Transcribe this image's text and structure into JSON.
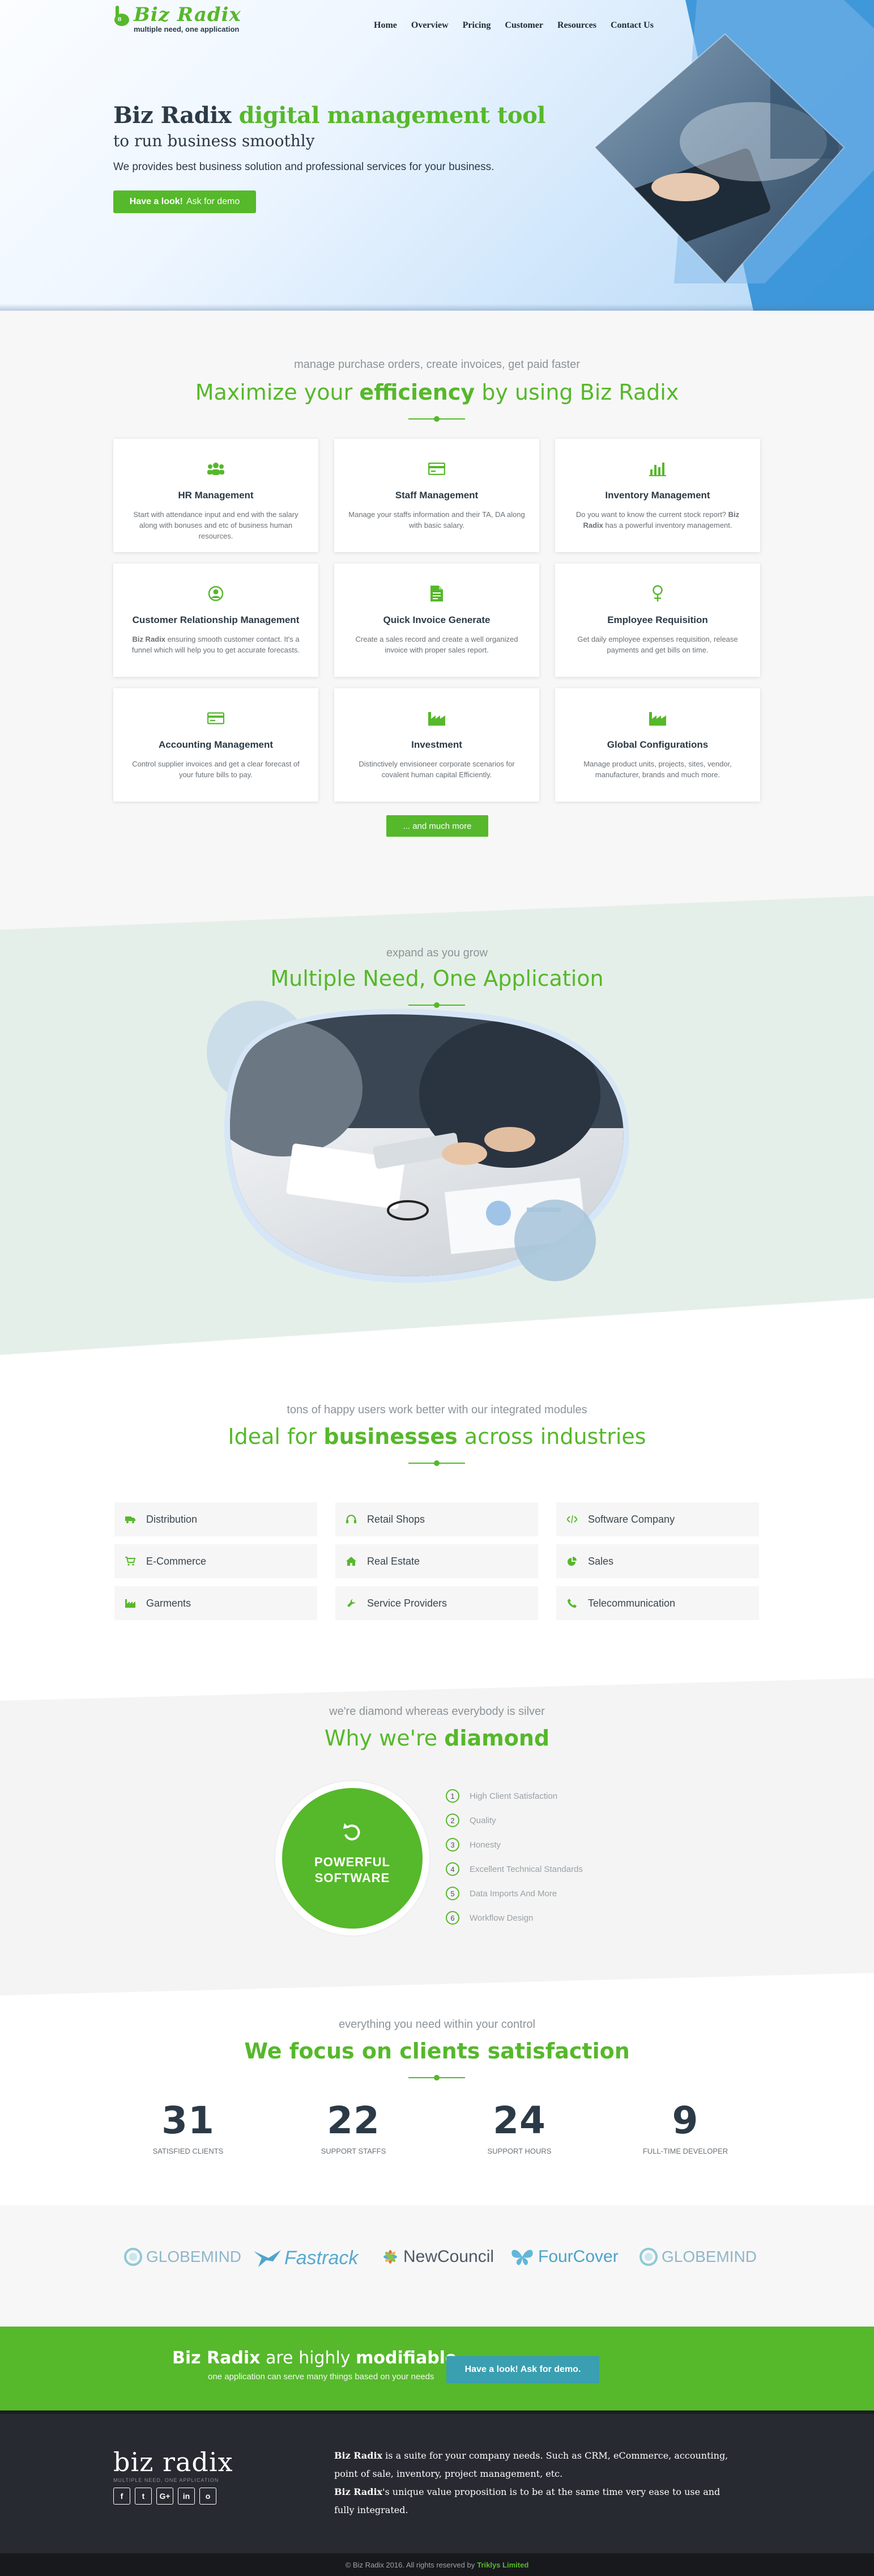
{
  "brand": {
    "name": "Biz Radix",
    "logo_badge": "B",
    "tagline": "multiple need, one application"
  },
  "nav": [
    "Home",
    "Overview",
    "Pricing",
    "Customer",
    "Resources",
    "Contact Us"
  ],
  "hero": {
    "title_plain": "Biz Radix ",
    "title_highlight": "digital management tool",
    "subtitle": "to run business smoothly",
    "description": "We provides best business solution and professional services for your business.",
    "cta_bold": "Have a look!",
    "cta_text": "Ask for demo"
  },
  "features": {
    "sub": "manage purchase orders, create invoices, get paid faster",
    "title_a": "Maximize your ",
    "title_b": "efficiency",
    "title_c": " by using Biz Radix",
    "cards": [
      {
        "icon": "users-icon",
        "title": "HR Management",
        "text": "Start with attendance input and end with the salary along with bonuses and etc of business human resources."
      },
      {
        "icon": "card-icon",
        "title": "Staff Management",
        "text": "Manage your staffs information and their TA, DA along with basic salary."
      },
      {
        "icon": "bar-chart-icon",
        "title": "Inventory Management",
        "text_a": "Do you want to know the current stock report? ",
        "text_b": "Biz Radix",
        "text_c": " has a powerful inventory management."
      },
      {
        "icon": "user-circle-icon",
        "title": "Customer Relationship Management",
        "text_a": "",
        "text_b": "Biz Radix",
        "text_c": " ensuring smooth customer contact. It's a funnel which will help you to get accurate forecasts."
      },
      {
        "icon": "invoice-icon",
        "title": "Quick Invoice Generate",
        "text": "Create a sales record and create a well organized invoice with proper sales report."
      },
      {
        "icon": "female-icon",
        "title": "Employee Requisition",
        "text": "Get daily employee expenses requisition, release payments and get bills on time."
      },
      {
        "icon": "money-icon",
        "title": "Accounting Management",
        "text": "Control supplier invoices and get a clear forecast of your future bills to pay."
      },
      {
        "icon": "industry-icon",
        "title": "Investment",
        "text": "Distinctively envisioneer corporate scenarios for covalent human capital Efficiently."
      },
      {
        "icon": "industry-icon",
        "title": "Global Configurations",
        "text": "Manage product units, projects, sites, vendor, manufacturer, brands and much more."
      }
    ],
    "more_button": "... and much more"
  },
  "expand": {
    "sub": "expand as you grow",
    "title": "Multiple Need, One Application"
  },
  "industries": {
    "sub": "tons of happy users work better with our integrated modules",
    "title_a": "Ideal for ",
    "title_b": "businesses",
    "title_c": " across industries",
    "items": [
      {
        "icon": "truck-icon",
        "label": "Distribution"
      },
      {
        "icon": "headset-icon",
        "label": "Retail Shops"
      },
      {
        "icon": "code-icon",
        "label": "Software Company"
      },
      {
        "icon": "cart-icon",
        "label": "E-Commerce"
      },
      {
        "icon": "home-icon",
        "label": "Real Estate"
      },
      {
        "icon": "chart-pie-icon",
        "label": "Sales"
      },
      {
        "icon": "industry-icon",
        "label": "Garments"
      },
      {
        "icon": "wrench-icon",
        "label": "Service Providers"
      },
      {
        "icon": "phone-icon",
        "label": "Telecommunication"
      }
    ]
  },
  "diamond": {
    "sub": "we're diamond whereas everybody is silver",
    "title_a": "Why we're ",
    "title_b": "diamond",
    "badge_line1": "POWERFUL",
    "badge_line2": "SOFTWARE",
    "list": [
      {
        "num": "1",
        "label": "High Client Satisfaction"
      },
      {
        "num": "2",
        "label": "Quality"
      },
      {
        "num": "3",
        "label": "Honesty"
      },
      {
        "num": "4",
        "label": "Excellent Technical Standards"
      },
      {
        "num": "5",
        "label": "Data Imports And More"
      },
      {
        "num": "6",
        "label": "Workflow Design"
      }
    ]
  },
  "stats": {
    "sub": "everything you need within your control",
    "title": "We focus on clients satisfaction",
    "items": [
      {
        "value": "31",
        "label": "SATISFIED CLIENTS"
      },
      {
        "value": "22",
        "label": "SUPPORT STAFFS"
      },
      {
        "value": "24",
        "label": "SUPPORT HOURS"
      },
      {
        "value": "9",
        "label": "FULL-TIME DEVELOPER"
      }
    ]
  },
  "partners": [
    "GLOBEMIND",
    "Fastrack",
    "NewCouncil",
    "FourCover",
    "GLOBEMIND"
  ],
  "cta": {
    "a": "Biz Radix",
    "b": " are highly ",
    "c": "modifiable",
    "small": "one application can serve many things based on your needs",
    "button": "Have a look! Ask for demo."
  },
  "footer": {
    "logo": "biz radix",
    "logo_tag": "MULTIPLE NEED, ONE APPLICATION",
    "socials": [
      "f",
      "t",
      "G+",
      "in",
      "o"
    ],
    "text_line1_bold": "Biz Radix",
    "text_line1": " is a suite for your company needs. Such as CRM, eCommerce, accounting, point of sale, inventory, project management, etc.",
    "text_line2_bold": "Biz Radix",
    "text_line2": "'s unique value proposition is to be at the same time very ease to use and fully integrated.",
    "copyright": "© Biz Radix 2016. All rights reserved by",
    "company": "Triklys Limited"
  },
  "colors": {
    "accent": "#56b82b",
    "ink": "#2b3a46",
    "button_alt": "#3a9fb0",
    "footer": "#272a30"
  }
}
